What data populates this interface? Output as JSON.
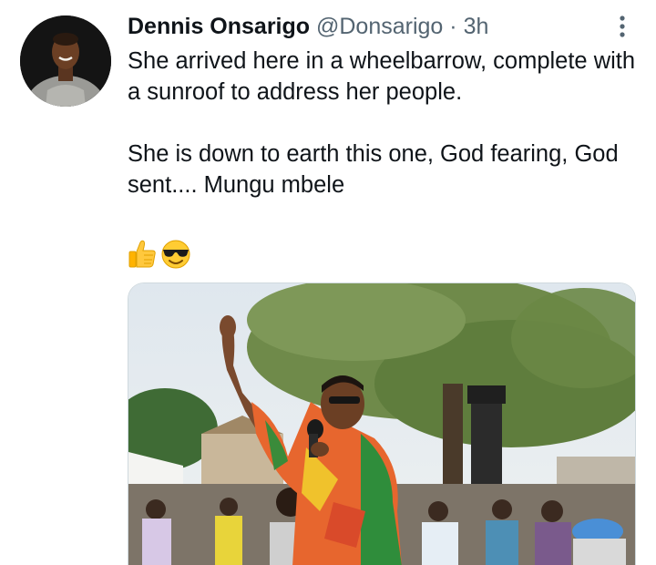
{
  "tweet": {
    "author_name": "Dennis Onsarigo",
    "handle": "@Donsarigo",
    "separator": "·",
    "time": "3h",
    "paragraphs": [
      "She arrived here in a wheelbarrow, complete with a sunroof to address her people.",
      "She is down to earth this one, God fearing, God sent.... Mungu mbele"
    ],
    "emojis": [
      "thumbs-up",
      "smiling-face-with-sunglasses"
    ],
    "media": {
      "kind": "photo",
      "subject": "woman in colorful dress speaking into microphone with raised hand before a crowd"
    }
  },
  "colors": {
    "text": "#0f1419",
    "secondary": "#536471",
    "background": "#ffffff"
  }
}
